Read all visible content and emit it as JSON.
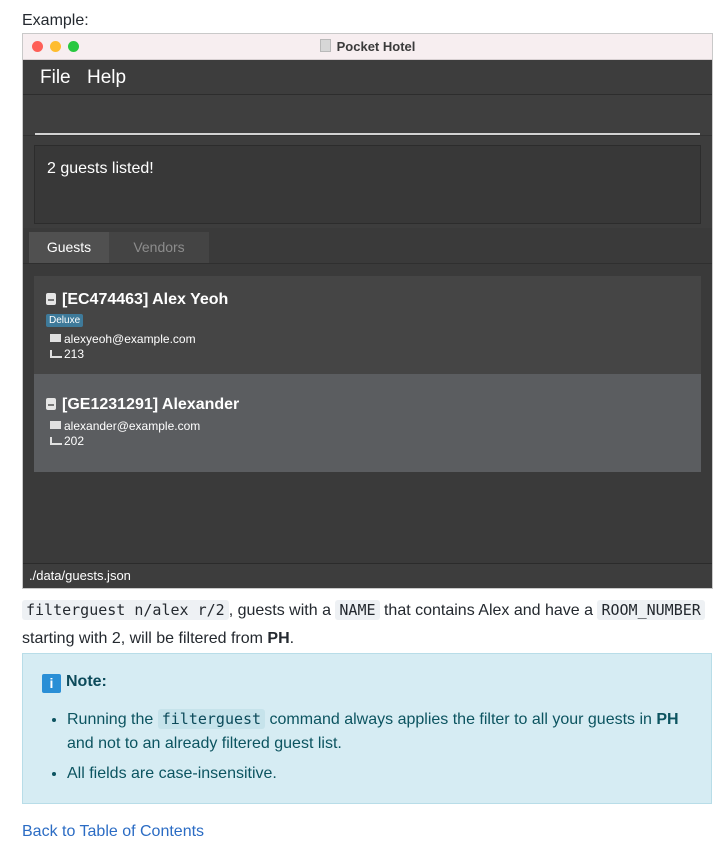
{
  "example_label": "Example:",
  "window": {
    "title": "Pocket Hotel",
    "menu": {
      "file": "File",
      "help": "Help"
    },
    "command_input": {
      "value": "",
      "placeholder": ""
    },
    "result_message": "2 guests listed!",
    "tabs": [
      {
        "label": "Guests",
        "active": true
      },
      {
        "label": "Vendors",
        "active": false
      }
    ],
    "guests": [
      {
        "name": "[EC474463] Alex Yeoh",
        "badge": "Deluxe",
        "email": "alexyeoh@example.com",
        "room": "213"
      },
      {
        "name": "[GE1231291] Alexander",
        "badge": "",
        "email": "alexander@example.com",
        "room": "202"
      }
    ],
    "status_path": "./data/guests.json"
  },
  "description": {
    "command": "filterguest n/alex r/2",
    "text1": ", guests with a ",
    "name_code": "NAME",
    "text2": " that contains Alex and have a ",
    "room_code": "ROOM_NUMBER",
    "text3": " starting with 2, will be filtered from ",
    "ph": "PH",
    "end": "."
  },
  "note": {
    "heading": "Note:",
    "item1_pre": "Running the ",
    "item1_code": "filterguest",
    "item1_mid": " command always applies the filter to all your guests in ",
    "item1_ph": "PH",
    "item1_post": " and not to an already filtered guest list.",
    "item2": "All fields are case-insensitive."
  },
  "toc_link": "Back to Table of Contents",
  "colors": {
    "info_accent": "#2a8fd6",
    "link": "#2b6cc4",
    "deluxe_badge": "#3e7a9a"
  }
}
